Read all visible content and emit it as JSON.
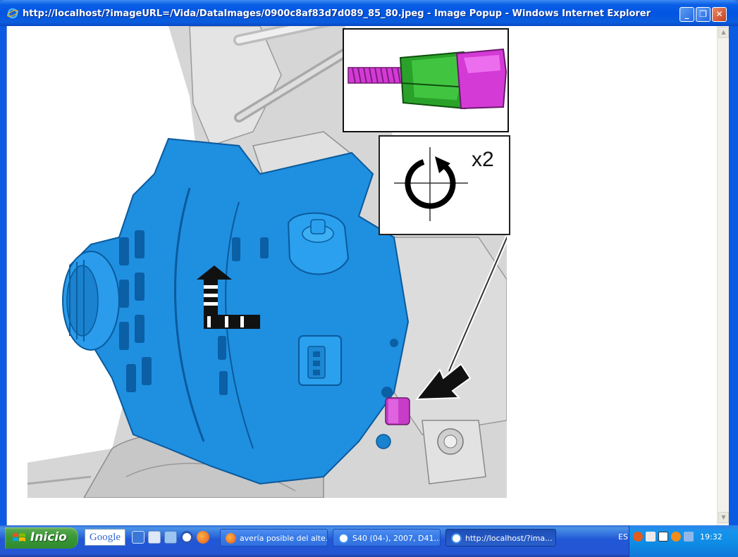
{
  "window": {
    "title": "http://localhost/?imageURL=/Vida/DataImages/0900c8af83d7d089_85_80.jpeg - Image Popup - Windows Internet Explorer",
    "minimize_icon": "minimize-icon",
    "restore_icon": "restore-icon",
    "close_icon": "close-icon"
  },
  "diagram": {
    "rotation_count": "x2",
    "icons": [
      "alternator-illustration",
      "bolt-inset",
      "counterclockwise-rotation-icon",
      "pointer-arrow",
      "lift-arrow"
    ],
    "colors": {
      "alternator": "#1f8fe0",
      "bolt": "#d43ad6",
      "nut": "#2aa22a"
    }
  },
  "taskbar": {
    "start_label": "Inicio",
    "google_label": "Google",
    "tasks": [
      {
        "label": "avería posible del alte...",
        "icon": "firefox-icon"
      },
      {
        "label": "S40 (04-), 2007, D41...",
        "icon": "ie-icon"
      },
      {
        "label": "http://localhost/?ima...",
        "icon": "ie-icon"
      }
    ],
    "language": "ES",
    "clock": "19:32"
  }
}
